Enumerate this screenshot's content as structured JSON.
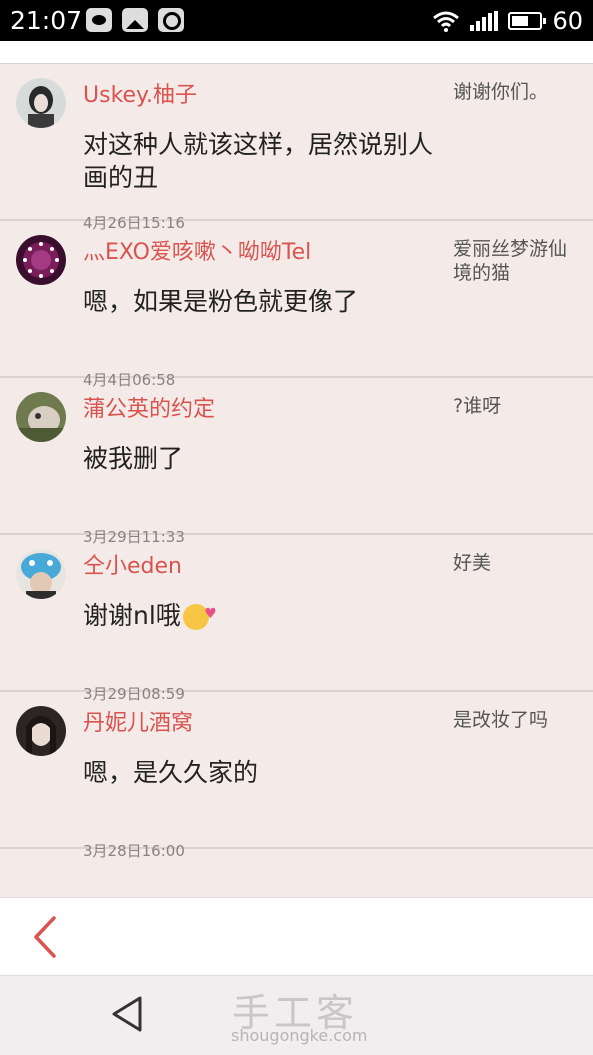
{
  "status_bar": {
    "time": "21:07",
    "battery": "60"
  },
  "comments": [
    {
      "user": "Uskey.柚子",
      "text": "对这种人就该这样，居然说别人画的丑",
      "time": "4月26日15:16",
      "reply": "谢谢你们。"
    },
    {
      "user": "灬EXO爱咳嗽丶呦呦Tel",
      "text": "嗯，如果是粉色就更像了",
      "time": "4月4日06:58",
      "reply": "爱丽丝梦游仙境的猫"
    },
    {
      "user": "蒲公英的约定",
      "text": "被我删了",
      "time": "3月29日11:33",
      "reply": "?谁呀"
    },
    {
      "user": "仝小eden",
      "text": "谢谢nl哦",
      "time": "3月29日08:59",
      "reply": "好美"
    },
    {
      "user": "丹妮儿酒窝",
      "text": "嗯，是久久家的",
      "time": "3月28日16:00",
      "reply": "是改妆了吗"
    }
  ],
  "watermark": {
    "logo": "手工客",
    "url": "shougongke.com"
  },
  "colors": {
    "accent": "#d9534f",
    "background": "#f4ebe9"
  }
}
